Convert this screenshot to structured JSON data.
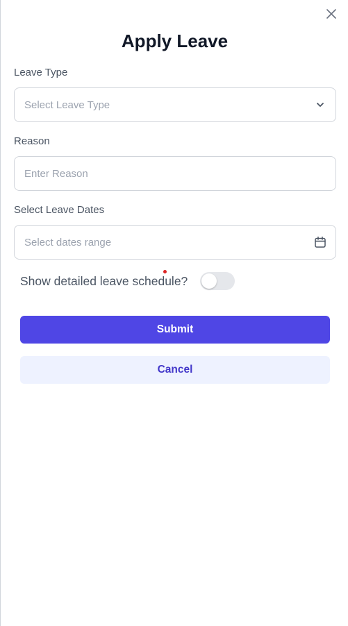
{
  "dialog": {
    "title": "Apply Leave"
  },
  "form": {
    "leave_type": {
      "label": "Leave Type",
      "placeholder": "Select Leave Type"
    },
    "reason": {
      "label": "Reason",
      "placeholder": "Enter Reason"
    },
    "dates": {
      "label": "Select Leave Dates",
      "placeholder": "Select dates range"
    },
    "schedule_toggle": {
      "label": "Show detailed leave schedule?",
      "checked": false
    }
  },
  "actions": {
    "submit_label": "Submit",
    "cancel_label": "Cancel"
  },
  "icons": {
    "close": "close-icon",
    "dropdown": "chevron-down-icon",
    "calendar": "calendar-icon"
  },
  "colors": {
    "primary": "#4f46e5",
    "cancel_bg": "#eef2ff",
    "cancel_text": "#4338ca"
  }
}
